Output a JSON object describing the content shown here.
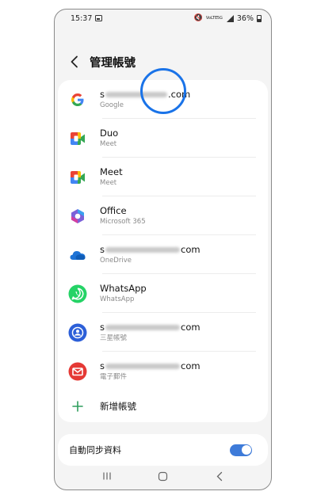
{
  "status_bar": {
    "time": "15:37",
    "net_label_1": "VoLTE",
    "net_label_2": "5G",
    "battery": "36%"
  },
  "header": {
    "title": "管理帳號"
  },
  "accounts": [
    {
      "id": "google",
      "icon": "google-icon",
      "title_prefix": "s",
      "title_suffix": ".com",
      "subtitle": "Google"
    },
    {
      "id": "duo",
      "icon": "duo-icon",
      "title": "Duo",
      "subtitle": "Meet"
    },
    {
      "id": "meet",
      "icon": "meet-icon",
      "title": "Meet",
      "subtitle": "Meet"
    },
    {
      "id": "office",
      "icon": "office-icon",
      "title": "Office",
      "subtitle": "Microsoft 365"
    },
    {
      "id": "onedrive",
      "icon": "onedrive-icon",
      "title_prefix": "s",
      "title_suffix": "com",
      "subtitle": "OneDrive"
    },
    {
      "id": "whatsapp",
      "icon": "whatsapp-icon",
      "title": "WhatsApp",
      "subtitle": "WhatsApp"
    },
    {
      "id": "samsung",
      "icon": "samsung-account-icon",
      "title_prefix": "s",
      "title_suffix": "com",
      "subtitle": "三星帳號"
    },
    {
      "id": "email",
      "icon": "email-icon",
      "title_prefix": "s",
      "title_suffix": "com",
      "subtitle": "電子郵件"
    }
  ],
  "add_account": {
    "label": "新增帳號"
  },
  "sync": {
    "label": "自動同步資料",
    "enabled": true
  },
  "colors": {
    "accent": "#3e7bd9",
    "touch_ring": "#1a73e8",
    "whatsapp": "#25d366",
    "email": "#e53935",
    "samsung": "#2c5fd8"
  }
}
